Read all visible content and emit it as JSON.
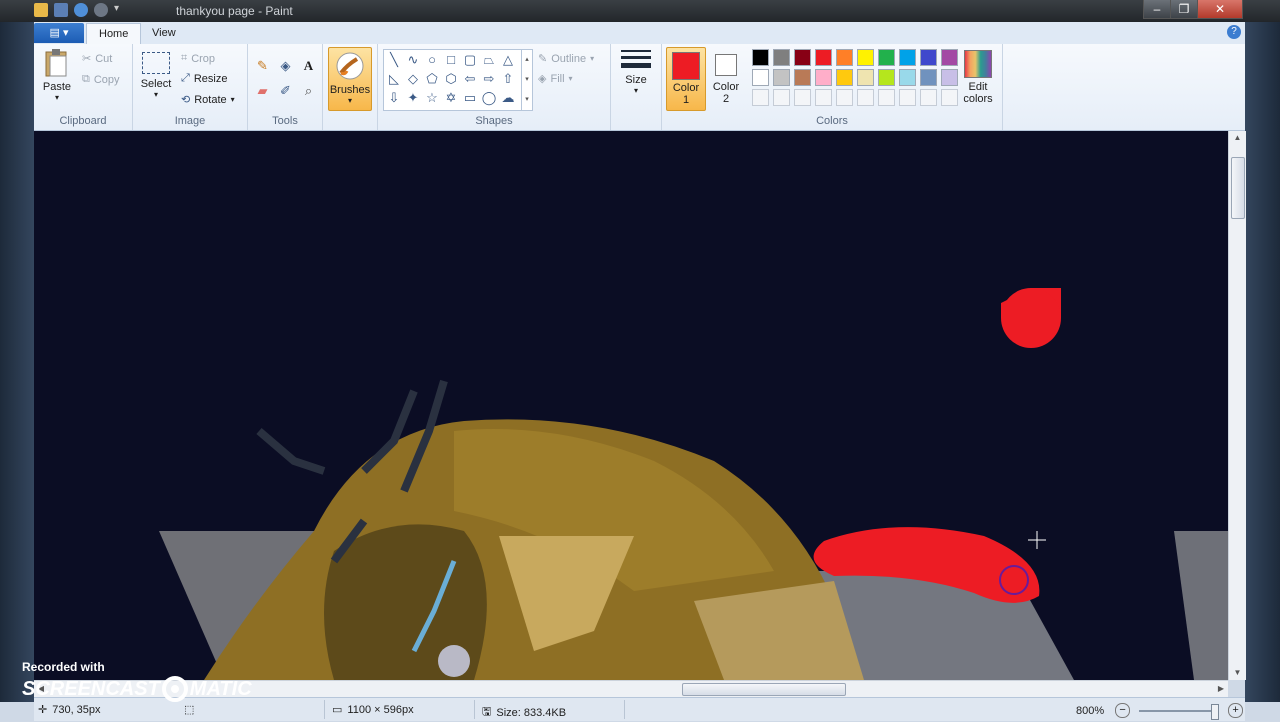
{
  "window": {
    "title": "thankyou page - Paint",
    "minimize": "–",
    "maximize": "❐",
    "close": "✕"
  },
  "tabs": {
    "file": "▤ ▾",
    "home": "Home",
    "view": "View",
    "help": "?"
  },
  "ribbon": {
    "clipboard": {
      "label": "Clipboard",
      "paste": "Paste",
      "cut": "Cut",
      "copy": "Copy"
    },
    "image": {
      "label": "Image",
      "select": "Select",
      "crop": "Crop",
      "resize": "Resize",
      "rotate": "Rotate"
    },
    "tools": {
      "label": "Tools"
    },
    "brushes": {
      "label": "Brushes"
    },
    "shapes": {
      "label": "Shapes",
      "outline": "Outline",
      "fill": "Fill"
    },
    "size": {
      "label": "Size"
    },
    "colors": {
      "label": "Colors",
      "color1": "Color",
      "color1_num": "1",
      "color2": "Color",
      "color2_num": "2",
      "edit_line1": "Edit",
      "edit_line2": "colors",
      "color1_value": "#ed1c24",
      "color2_value": "#ffffff",
      "palette_row1": [
        "#000000",
        "#7f7f7f",
        "#880015",
        "#ed1c24",
        "#ff7f27",
        "#fff200",
        "#22b14c",
        "#00a2e8",
        "#3f48cc",
        "#a349a4"
      ],
      "palette_row2": [
        "#ffffff",
        "#c3c3c3",
        "#b97a57",
        "#ffaec9",
        "#ffc90e",
        "#efe4b0",
        "#b5e61d",
        "#99d9ea",
        "#7092be",
        "#c8bfe7"
      ]
    }
  },
  "status": {
    "cursor_pos": "730, 35px",
    "canvas_size": "1100 × 596px",
    "file_size": "Size: 833.4KB",
    "zoom": "800%"
  },
  "watermark": {
    "line1": "Recorded with",
    "brand_left": "SCREENCAST",
    "brand_right": "MATIC"
  }
}
